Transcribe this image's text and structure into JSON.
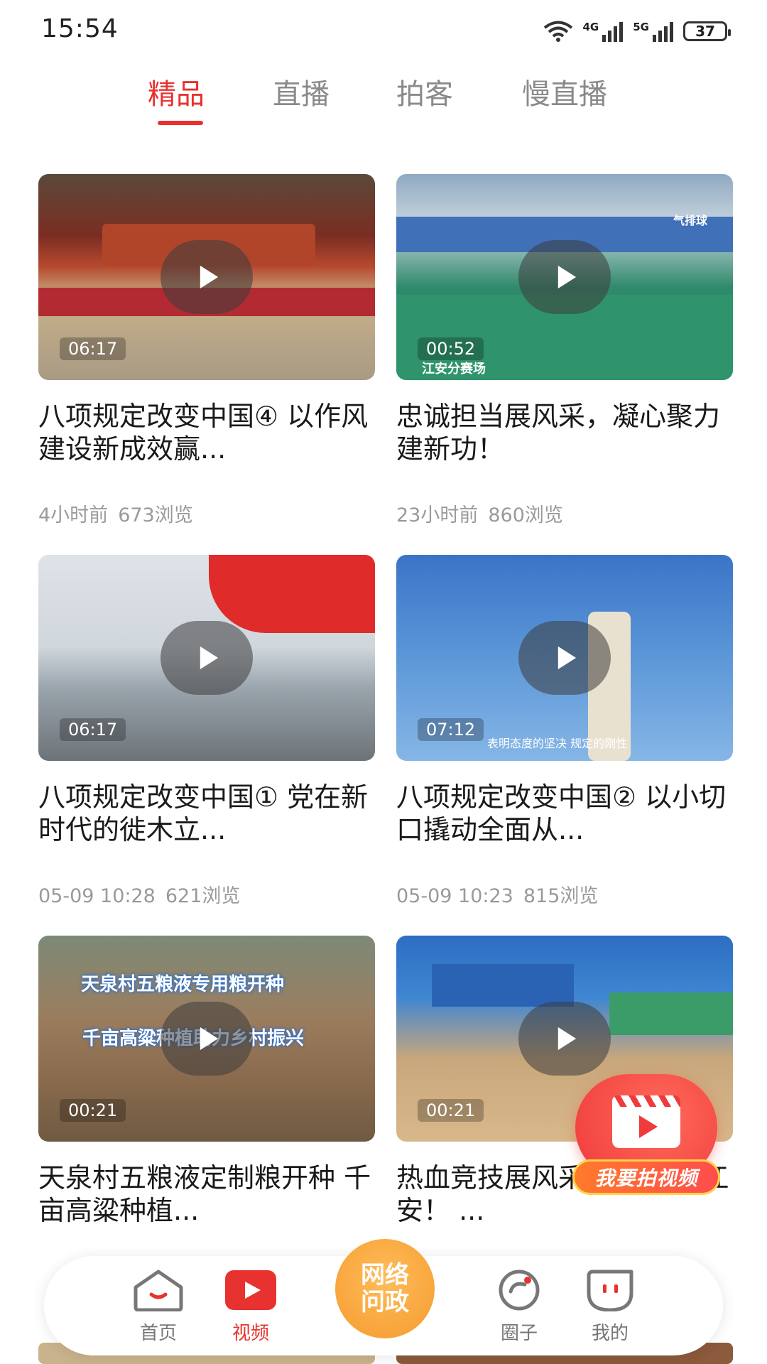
{
  "status_bar": {
    "time": "15:54",
    "network_1": "4G",
    "network_2": "5G",
    "battery": "37"
  },
  "tabs": [
    {
      "label": "精品",
      "active": true
    },
    {
      "label": "直播",
      "active": false
    },
    {
      "label": "拍客",
      "active": false
    },
    {
      "label": "慢直播",
      "active": false
    }
  ],
  "videos": [
    {
      "duration": "06:17",
      "title": "八项规定改变中国④ 以作风建设新成效赢...",
      "time": "4小时前",
      "views": "673浏览"
    },
    {
      "duration": "00:52",
      "title": "忠诚担当展风采，凝心聚力建新功！",
      "time": "23小时前",
      "views": "860浏览",
      "thumb_caption": "气排球",
      "thumb_place": "江安分赛场"
    },
    {
      "duration": "06:17",
      "title": "八项规定改变中国① 党在新时代的徙木立...",
      "time": "05-09 10:28",
      "views": "621浏览"
    },
    {
      "duration": "07:12",
      "title": "八项规定改变中国② 以小切口撬动全面从...",
      "time": "05-09 10:23",
      "views": "815浏览",
      "thumb_caption": "表明态度的坚决 规定的刚性"
    },
    {
      "duration": "00:21",
      "title": "天泉村五粮液定制粮开种 千亩高粱种植...",
      "thumb_line1": "天泉村五粮液专用粮开种",
      "thumb_line2": "千亩高粱种植助力乡村振兴"
    },
    {
      "duration": "00:21",
      "title": "热血竞技展风采 传铁军聚江安！ ..."
    }
  ],
  "fab": {
    "label": "我要拍视频"
  },
  "bottom_nav": {
    "home": "首页",
    "video": "视频",
    "center_line1": "网络",
    "center_line2": "问政",
    "circle": "圈子",
    "mine": "我的"
  },
  "colors": {
    "accent": "#e8322f",
    "center_button": "#f59b2e"
  }
}
